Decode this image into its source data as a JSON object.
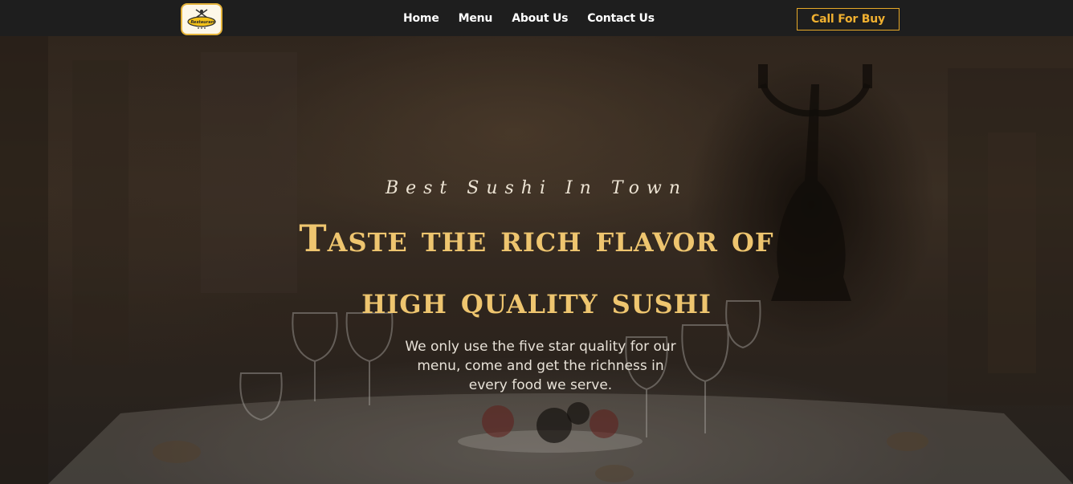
{
  "header": {
    "logo_text": "Restaurant",
    "nav": [
      {
        "label": "Home"
      },
      {
        "label": "Menu"
      },
      {
        "label": "About Us"
      },
      {
        "label": "Contact Us"
      }
    ],
    "cta_label": "Call For Buy"
  },
  "hero": {
    "tagline": "Best Sushi In Town",
    "headline_line1": "Taste the rich flavor of",
    "headline_line2": "high quality sushi",
    "description": "We only use the five star quality for our menu, come and get the richness in every food we serve."
  },
  "colors": {
    "header_bg": "#1e1e1e",
    "accent": "#e7a928",
    "headline": "#eec56f",
    "text_light": "#e8e2d8"
  }
}
